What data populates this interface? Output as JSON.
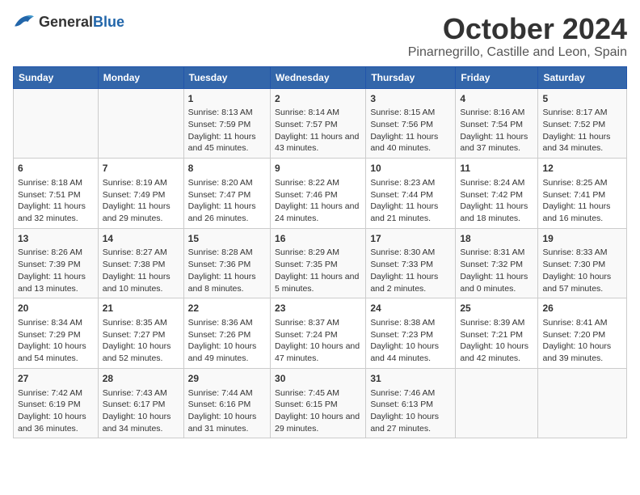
{
  "header": {
    "logo_general": "General",
    "logo_blue": "Blue",
    "title": "October 2024",
    "subtitle": "Pinarnegrillo, Castille and Leon, Spain"
  },
  "columns": [
    "Sunday",
    "Monday",
    "Tuesday",
    "Wednesday",
    "Thursday",
    "Friday",
    "Saturday"
  ],
  "weeks": [
    [
      {
        "day": "",
        "info": ""
      },
      {
        "day": "",
        "info": ""
      },
      {
        "day": "1",
        "info": "Sunrise: 8:13 AM\nSunset: 7:59 PM\nDaylight: 11 hours and 45 minutes."
      },
      {
        "day": "2",
        "info": "Sunrise: 8:14 AM\nSunset: 7:57 PM\nDaylight: 11 hours and 43 minutes."
      },
      {
        "day": "3",
        "info": "Sunrise: 8:15 AM\nSunset: 7:56 PM\nDaylight: 11 hours and 40 minutes."
      },
      {
        "day": "4",
        "info": "Sunrise: 8:16 AM\nSunset: 7:54 PM\nDaylight: 11 hours and 37 minutes."
      },
      {
        "day": "5",
        "info": "Sunrise: 8:17 AM\nSunset: 7:52 PM\nDaylight: 11 hours and 34 minutes."
      }
    ],
    [
      {
        "day": "6",
        "info": "Sunrise: 8:18 AM\nSunset: 7:51 PM\nDaylight: 11 hours and 32 minutes."
      },
      {
        "day": "7",
        "info": "Sunrise: 8:19 AM\nSunset: 7:49 PM\nDaylight: 11 hours and 29 minutes."
      },
      {
        "day": "8",
        "info": "Sunrise: 8:20 AM\nSunset: 7:47 PM\nDaylight: 11 hours and 26 minutes."
      },
      {
        "day": "9",
        "info": "Sunrise: 8:22 AM\nSunset: 7:46 PM\nDaylight: 11 hours and 24 minutes."
      },
      {
        "day": "10",
        "info": "Sunrise: 8:23 AM\nSunset: 7:44 PM\nDaylight: 11 hours and 21 minutes."
      },
      {
        "day": "11",
        "info": "Sunrise: 8:24 AM\nSunset: 7:42 PM\nDaylight: 11 hours and 18 minutes."
      },
      {
        "day": "12",
        "info": "Sunrise: 8:25 AM\nSunset: 7:41 PM\nDaylight: 11 hours and 16 minutes."
      }
    ],
    [
      {
        "day": "13",
        "info": "Sunrise: 8:26 AM\nSunset: 7:39 PM\nDaylight: 11 hours and 13 minutes."
      },
      {
        "day": "14",
        "info": "Sunrise: 8:27 AM\nSunset: 7:38 PM\nDaylight: 11 hours and 10 minutes."
      },
      {
        "day": "15",
        "info": "Sunrise: 8:28 AM\nSunset: 7:36 PM\nDaylight: 11 hours and 8 minutes."
      },
      {
        "day": "16",
        "info": "Sunrise: 8:29 AM\nSunset: 7:35 PM\nDaylight: 11 hours and 5 minutes."
      },
      {
        "day": "17",
        "info": "Sunrise: 8:30 AM\nSunset: 7:33 PM\nDaylight: 11 hours and 2 minutes."
      },
      {
        "day": "18",
        "info": "Sunrise: 8:31 AM\nSunset: 7:32 PM\nDaylight: 11 hours and 0 minutes."
      },
      {
        "day": "19",
        "info": "Sunrise: 8:33 AM\nSunset: 7:30 PM\nDaylight: 10 hours and 57 minutes."
      }
    ],
    [
      {
        "day": "20",
        "info": "Sunrise: 8:34 AM\nSunset: 7:29 PM\nDaylight: 10 hours and 54 minutes."
      },
      {
        "day": "21",
        "info": "Sunrise: 8:35 AM\nSunset: 7:27 PM\nDaylight: 10 hours and 52 minutes."
      },
      {
        "day": "22",
        "info": "Sunrise: 8:36 AM\nSunset: 7:26 PM\nDaylight: 10 hours and 49 minutes."
      },
      {
        "day": "23",
        "info": "Sunrise: 8:37 AM\nSunset: 7:24 PM\nDaylight: 10 hours and 47 minutes."
      },
      {
        "day": "24",
        "info": "Sunrise: 8:38 AM\nSunset: 7:23 PM\nDaylight: 10 hours and 44 minutes."
      },
      {
        "day": "25",
        "info": "Sunrise: 8:39 AM\nSunset: 7:21 PM\nDaylight: 10 hours and 42 minutes."
      },
      {
        "day": "26",
        "info": "Sunrise: 8:41 AM\nSunset: 7:20 PM\nDaylight: 10 hours and 39 minutes."
      }
    ],
    [
      {
        "day": "27",
        "info": "Sunrise: 7:42 AM\nSunset: 6:19 PM\nDaylight: 10 hours and 36 minutes."
      },
      {
        "day": "28",
        "info": "Sunrise: 7:43 AM\nSunset: 6:17 PM\nDaylight: 10 hours and 34 minutes."
      },
      {
        "day": "29",
        "info": "Sunrise: 7:44 AM\nSunset: 6:16 PM\nDaylight: 10 hours and 31 minutes."
      },
      {
        "day": "30",
        "info": "Sunrise: 7:45 AM\nSunset: 6:15 PM\nDaylight: 10 hours and 29 minutes."
      },
      {
        "day": "31",
        "info": "Sunrise: 7:46 AM\nSunset: 6:13 PM\nDaylight: 10 hours and 27 minutes."
      },
      {
        "day": "",
        "info": ""
      },
      {
        "day": "",
        "info": ""
      }
    ]
  ]
}
